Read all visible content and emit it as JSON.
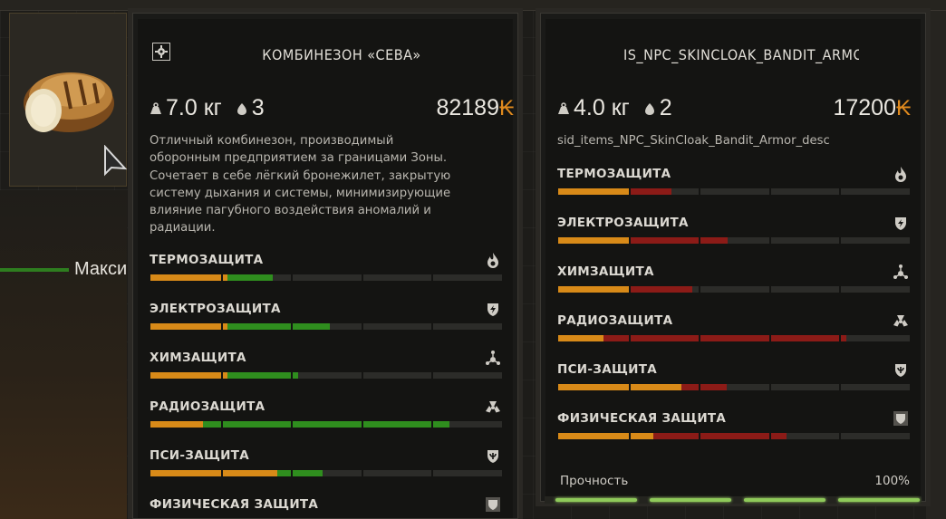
{
  "colors": {
    "orange": "#d88a18",
    "green": "#2f8e1e",
    "red": "#8c1b17",
    "empty": "#2c2c29",
    "ruble": "#e08a1e"
  },
  "background": {
    "partial_label": "Макси"
  },
  "left_item": {
    "title": "КОМБИНЕЗОН «СЕВА»",
    "weight": "7.0 кг",
    "slots": "3",
    "price": "82189",
    "currency_symbol": "₭",
    "description": "Отличный комбинезон, производимый оборонным предприятием за границами Зоны. Сочетает в себе лёгкий бронежилет, закрытую систему дыхания и системы, минимизирующие влияние пагубного воздействия аномалий и радиации.",
    "description_lines": [
      "Отличный комбинезон, производимый",
      "оборонным предприятием за границами Зоны.",
      "Сочетает в себе лёгкий бронежилет, закрытую",
      "систему дыхания и системы, минимизирующие",
      "влияние пагубного воздействия аномалий и",
      "радиации."
    ],
    "protections": [
      {
        "label": "ТЕРМОЗАЩИТА",
        "icon": "fire-icon",
        "orange": 0.22,
        "green": 0.13
      },
      {
        "label": "ЭЛЕКТРОЗАЩИТА",
        "icon": "lightning-shield-icon",
        "orange": 0.22,
        "green": 0.29
      },
      {
        "label": "ХИМЗАЩИТА",
        "icon": "chemical-icon",
        "orange": 0.22,
        "green": 0.2
      },
      {
        "label": "РАДИОЗАЩИТА",
        "icon": "radiation-icon",
        "orange": 0.15,
        "green": 0.7
      },
      {
        "label": "ПСИ-ЗАЩИТА",
        "icon": "psi-shield-icon",
        "orange": 0.36,
        "green": 0.13
      },
      {
        "label": "ФИЗИЧЕСКАЯ ЗАЩИТА",
        "icon": "armor-shield-icon",
        "orange": 0,
        "green": 0
      }
    ]
  },
  "right_item": {
    "title": "IS_NPC_SKINCLOAK_BANDIT_ARMO",
    "weight": "4.0 кг",
    "slots": "2",
    "price": "17200",
    "currency_symbol": "₭",
    "description": "sid_items_NPC_SkinCloak_Bandit_Armor_desc",
    "protections": [
      {
        "label": "ТЕРМОЗАЩИТА",
        "icon": "fire-icon",
        "orange": 0.2,
        "red": 0.12
      },
      {
        "label": "ЭЛЕКТРОЗАЩИТА",
        "icon": "lightning-shield-icon",
        "orange": 0.2,
        "red": 0.28
      },
      {
        "label": "ХИМЗАЩИТА",
        "icon": "chemical-icon",
        "orange": 0.2,
        "red": 0.18
      },
      {
        "label": "РАДИОЗАЩИТА",
        "icon": "radiation-icon",
        "orange": 0.13,
        "red": 0.69
      },
      {
        "label": "ПСИ-ЗАЩИТА",
        "icon": "psi-shield-icon",
        "orange": 0.35,
        "red": 0.13
      },
      {
        "label": "ФИЗИЧЕСКАЯ ЗАЩИТА",
        "icon": "armor-shield-icon",
        "orange": 0.27,
        "red": 0.38
      }
    ],
    "durability_label": "Прочность",
    "durability_value": "100%",
    "durability": 1.0
  }
}
